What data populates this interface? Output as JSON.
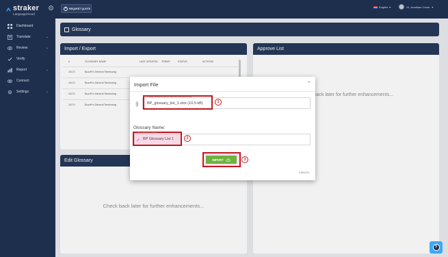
{
  "app": {
    "brand": "straker",
    "brand_sub": "LanguageCloud",
    "request_quote_label": "REQUEST QUOTE",
    "language": "English",
    "user_greeting": "Hi, Jonathan Crook"
  },
  "sidebar": {
    "items": [
      {
        "label": "Dashboard",
        "icon": "grid-icon"
      },
      {
        "label": "Translate",
        "icon": "translate-icon",
        "has_children": true
      },
      {
        "label": "Review",
        "icon": "eye-icon",
        "has_children": true
      },
      {
        "label": "Verify",
        "icon": "check-icon"
      },
      {
        "label": "Report",
        "icon": "chart-icon",
        "has_children": true
      },
      {
        "label": "Connect",
        "icon": "link-icon"
      },
      {
        "label": "Settings",
        "icon": "gear-icon",
        "has_children": true
      }
    ]
  },
  "page": {
    "title": "Glossary"
  },
  "import_export": {
    "title": "Import / Export",
    "columns": [
      "#",
      "GLOSSARY NAME",
      "LAST UPDATED",
      "TERMS",
      "STATUS",
      "ACTIONS"
    ],
    "rows": [
      {
        "id": "24171",
        "name": "BuzzPro General Terminolog"
      },
      {
        "id": "24171",
        "name": "BuzzPro General Terminolog"
      },
      {
        "id": "24171",
        "name": "BuzzPro General Terminolog"
      },
      {
        "id": "24171",
        "name": "BuzzPro General Terminolog"
      }
    ]
  },
  "approve_list": {
    "title": "Approve List",
    "message": "Check back later for further enhancements..."
  },
  "edit_glossary": {
    "title": "Edit Glossary",
    "message": "Check back later for further enhancements..."
  },
  "modal": {
    "title": "Import File",
    "close": "×",
    "file_hint": "Please select a .csv or .xlsx file extension only.",
    "file_value": "BP_glossary_list_1.xlsx (10.5 kB)",
    "glossary_name_label": "Glossary Name:",
    "glossary_name_hint": "Your glossary name",
    "glossary_name_value": "BP Glossary List 1",
    "import_label": "IMPORT",
    "cancel_label": "CANCEL"
  },
  "callouts": [
    "1",
    "2",
    "3"
  ],
  "colors": {
    "nav": "#1f3050",
    "header": "#263859",
    "accent_green": "#6db33f",
    "callout_red": "#c0181f",
    "help": "#3fa9f5"
  }
}
